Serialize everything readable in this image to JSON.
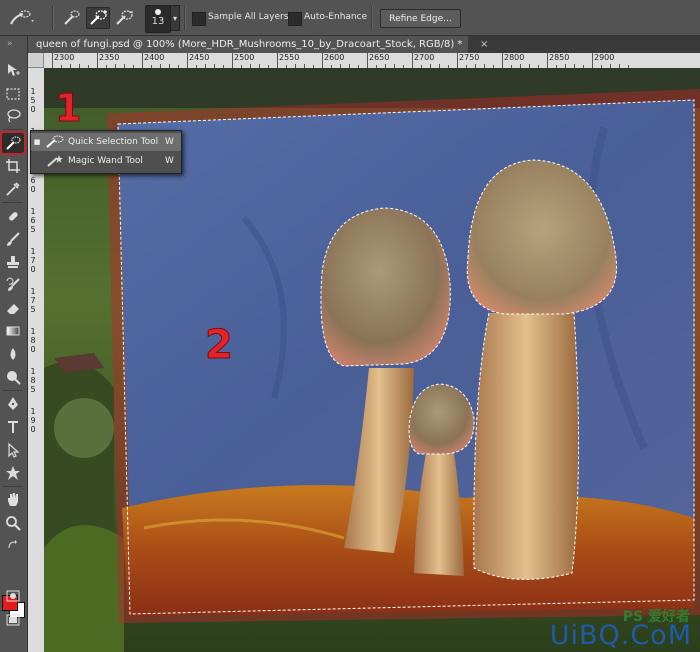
{
  "options_bar": {
    "brush_size": "13",
    "sample_all_layers_label": "Sample All Layers",
    "auto_enhance_label": "Auto-Enhance",
    "refine_edge_label": "Refine Edge..."
  },
  "document_tab": {
    "title": "queen of fungi.psd @ 100% (More_HDR_Mushrooms_10_by_Dracoart_Stock, RGB/8) *",
    "close_glyph": "×"
  },
  "ruler": {
    "horizontal_labels": [
      "2300",
      "2350",
      "2400",
      "2450",
      "2500",
      "2550",
      "2600",
      "2650",
      "2700",
      "2750",
      "2800",
      "2850",
      "2900"
    ],
    "vertical_labels": [
      "1",
      "5",
      "0",
      "1",
      "5",
      "5",
      "1",
      "6",
      "0",
      "1",
      "6",
      "5",
      "1",
      "7",
      "0",
      "1",
      "7",
      "5",
      "1",
      "8",
      "0",
      "1",
      "8",
      "5",
      "1",
      "9",
      "0"
    ]
  },
  "tool_flyout": {
    "items": [
      {
        "label": "Quick Selection Tool",
        "shortcut": "W",
        "selected": true
      },
      {
        "label": "Magic Wand Tool",
        "shortcut": "W",
        "selected": false
      }
    ]
  },
  "annotations": {
    "step1": "1",
    "step2": "2"
  },
  "colors": {
    "foreground": "#e21b1b",
    "background": "#ffffff",
    "highlight": "#c0262c"
  },
  "watermark": {
    "line1": "PS 爱好者",
    "line2": "UiBQ.CoM"
  },
  "icons": [
    "quick-selection-brush-icon",
    "new-selection-icon",
    "add-to-selection-icon",
    "subtract-from-selection-icon",
    "move-icon",
    "marquee-icon",
    "lasso-icon",
    "quick-selection-icon",
    "crop-icon",
    "eyedropper-icon",
    "healing-brush-icon",
    "brush-icon",
    "clone-stamp-icon",
    "history-brush-icon",
    "eraser-icon",
    "gradient-icon",
    "blur-icon",
    "dodge-icon",
    "pen-icon",
    "type-icon",
    "path-selection-icon",
    "shape-icon",
    "hand-icon",
    "zoom-icon",
    "magic-wand-icon"
  ]
}
